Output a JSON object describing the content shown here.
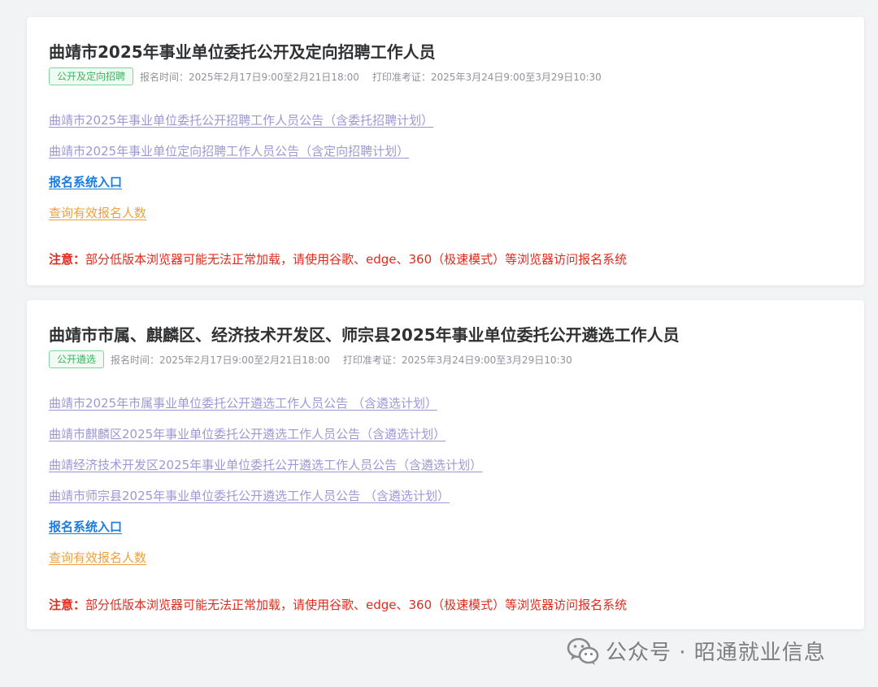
{
  "cards": [
    {
      "title": "曲靖市2025年事业单位委托公开及定向招聘工作人员",
      "tag": "公开及定向招聘",
      "signup_time": "报名时间：2025年2月17日9:00至2月21日18:00",
      "print_time": "打印准考证：2025年3月24日9:00至3月29日10:30",
      "notices": [
        "曲靖市2025年事业单位委托公开招聘工作人员公告（含委托招聘计划）",
        "曲靖市2025年事业单位定向招聘工作人员公告（含定向招聘计划）"
      ],
      "system_entry": "报名系统入口",
      "query_count": "查询有效报名人数",
      "warning_label": "注意：",
      "warning_text": "部分低版本浏览器可能无法正常加载，请使用谷歌、edge、360（极速模式）等浏览器访问报名系统"
    },
    {
      "title": "曲靖市市属、麒麟区、经济技术开发区、师宗县2025年事业单位委托公开遴选工作人员",
      "tag": "公开遴选",
      "signup_time": "报名时间：2025年2月17日9:00至2月21日18:00",
      "print_time": "打印准考证：2025年3月24日9:00至3月29日10:30",
      "notices": [
        "曲靖市2025年市属事业单位委托公开遴选工作人员公告 （含遴选计划）",
        "曲靖市麒麟区2025年事业单位委托公开遴选工作人员公告（含遴选计划）",
        "曲靖经济技术开发区2025年事业单位委托公开遴选工作人员公告（含遴选计划）",
        "曲靖市师宗县2025年事业单位委托公开遴选工作人员公告 （含遴选计划）"
      ],
      "system_entry": "报名系统入口",
      "query_count": "查询有效报名人数",
      "warning_label": "注意：",
      "warning_text": "部分低版本浏览器可能无法正常加载，请使用谷歌、edge、360（极速模式）等浏览器访问报名系统"
    }
  ],
  "watermark": {
    "icon": "wechat-icon",
    "text": "公众号 · 昭通就业信息"
  },
  "colors": {
    "tag_green": "#3cb55f",
    "notice_link": "#9c98d4",
    "system_link": "#1a7de0",
    "count_link": "#f0a03c",
    "warning_red": "#e02b1f"
  }
}
